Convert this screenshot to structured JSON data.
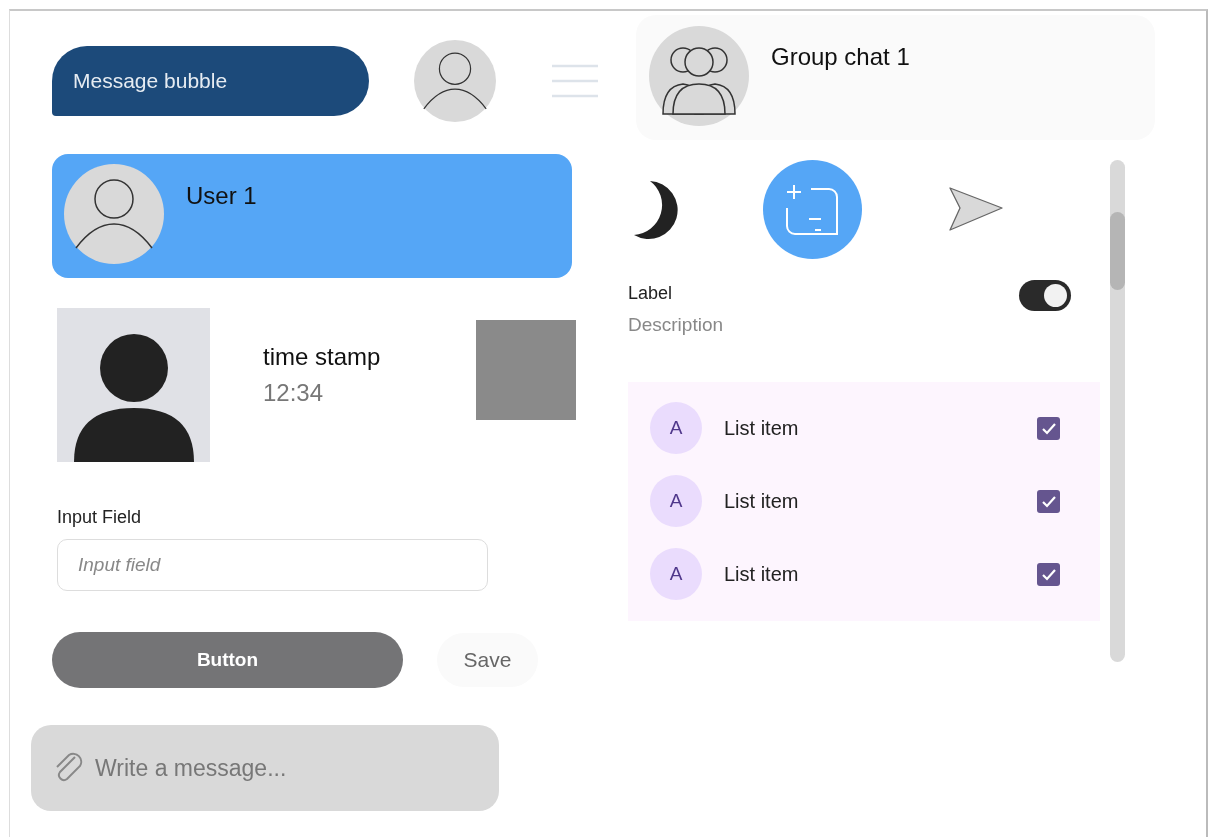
{
  "message_bubble": {
    "text": "Message bubble"
  },
  "user_card": {
    "name": "User 1"
  },
  "media": {
    "caption": "time stamp",
    "time": "12:34"
  },
  "input": {
    "label": "Input Field",
    "placeholder": "Input field"
  },
  "buttons": [
    {
      "label": "Button",
      "kind": "primary"
    },
    {
      "label": "Save",
      "kind": "secondary"
    }
  ],
  "composer": {
    "placeholder": "Write a message..."
  },
  "group_chat": {
    "name": "Group chat 1"
  },
  "setting": {
    "label": "Label",
    "description": "Description",
    "on": true
  },
  "list": [
    {
      "avatar": "A",
      "label": "List item",
      "checked": true
    },
    {
      "avatar": "A",
      "label": "List item",
      "checked": true
    },
    {
      "avatar": "A",
      "label": "List item",
      "checked": true
    }
  ]
}
